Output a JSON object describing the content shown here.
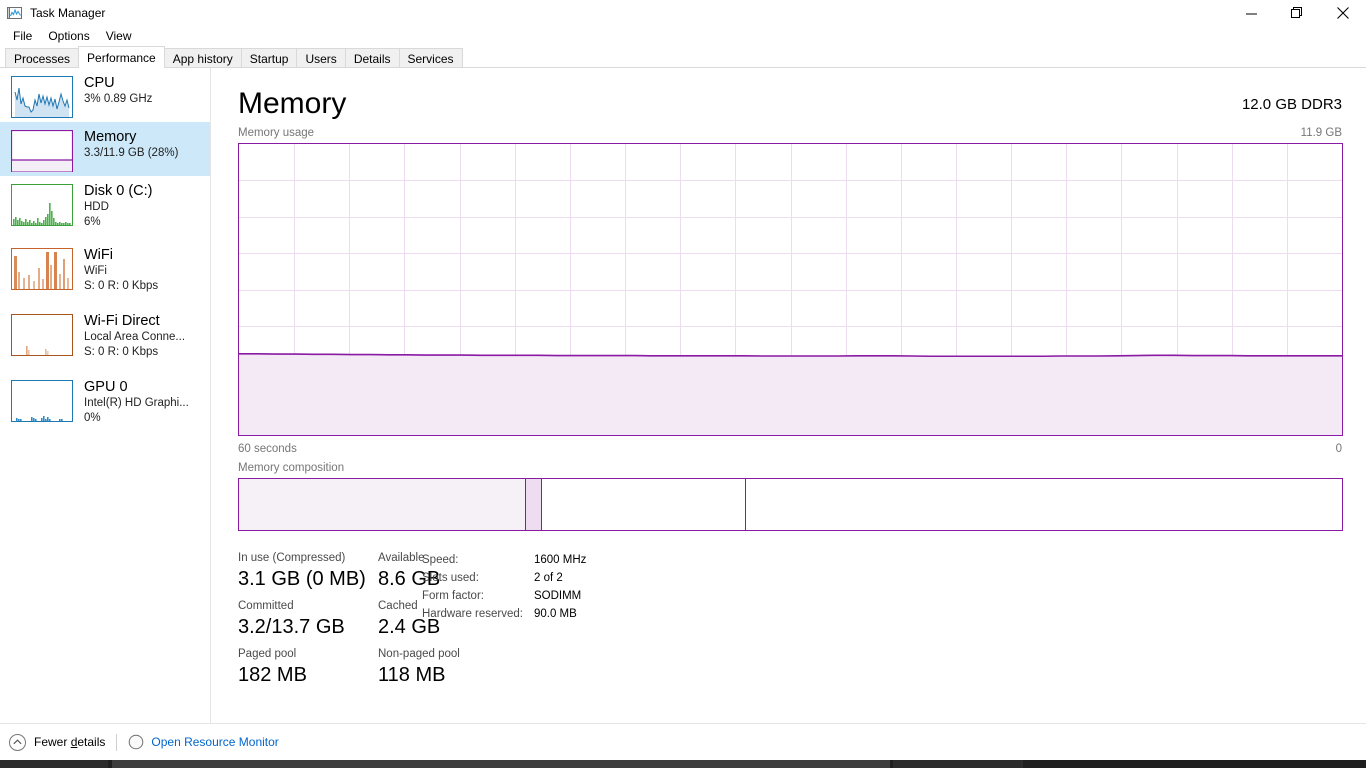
{
  "window": {
    "title": "Task Manager",
    "icon": "task-manager-icon",
    "controls": {
      "minimize": "—",
      "maximize": "❐",
      "close": "✕"
    }
  },
  "menubar": {
    "items": [
      "File",
      "Options",
      "View"
    ]
  },
  "tabs": [
    {
      "label": "Processes",
      "active": false
    },
    {
      "label": "Performance",
      "active": true
    },
    {
      "label": "App history",
      "active": false
    },
    {
      "label": "Startup",
      "active": false
    },
    {
      "label": "Users",
      "active": false
    },
    {
      "label": "Details",
      "active": false
    },
    {
      "label": "Services",
      "active": false
    }
  ],
  "sidebar": {
    "items": [
      {
        "name": "CPU",
        "line2": "3%  0.89 GHz",
        "line3": "",
        "color": "#1f77b4",
        "selected": false
      },
      {
        "name": "Memory",
        "line2": "3.3/11.9 GB (28%)",
        "line3": "",
        "color": "#8a19a3",
        "selected": true
      },
      {
        "name": "Disk 0 (C:)",
        "line2": "HDD",
        "line3": "6%",
        "color": "#3aa03a",
        "selected": false
      },
      {
        "name": "WiFi",
        "line2": "WiFi",
        "line3": "S: 0 R: 0 Kbps",
        "color": "#c4642a",
        "selected": false
      },
      {
        "name": "Wi-Fi Direct",
        "line2": "Local Area Conne...",
        "line3": "S: 0 R: 0 Kbps",
        "color": "#a8541f",
        "selected": false
      },
      {
        "name": "GPU 0",
        "line2": "Intel(R) HD Graphi...",
        "line3": "0%",
        "color": "#1f77b4",
        "selected": false
      }
    ]
  },
  "main": {
    "title": "Memory",
    "subtitle": "12.0 GB DDR3",
    "graph_label": "Memory usage",
    "graph_max": "11.9 GB",
    "graph_foot_left": "60 seconds",
    "graph_foot_right": "0",
    "composition_label": "Memory composition",
    "accent_color": "#8a19a3"
  },
  "chart_data": {
    "type": "area",
    "title": "Memory usage",
    "ylabel": "",
    "xlabel": "",
    "ylim": [
      0,
      11.9
    ],
    "xlim": [
      60,
      0
    ],
    "y_max_label": "11.9 GB",
    "x_left_label": "60 seconds",
    "x_right_label": "0",
    "grid": true,
    "grid_columns": 20,
    "grid_rows": 8,
    "line_color": "#8a19a3",
    "fill_color": "#f3eaf5",
    "series": [
      {
        "name": "In use",
        "unit": "GB",
        "values": [
          3.32,
          3.32,
          3.31,
          3.31,
          3.3,
          3.3,
          3.29,
          3.29,
          3.28,
          3.28,
          3.27,
          3.27,
          3.27,
          3.26,
          3.26,
          3.26,
          3.26,
          3.25,
          3.25,
          3.25,
          3.25,
          3.25,
          3.24,
          3.24,
          3.24,
          3.24,
          3.24,
          3.24,
          3.23,
          3.23,
          3.23,
          3.23,
          3.23,
          3.24,
          3.24,
          3.24,
          3.23,
          3.22,
          3.22,
          3.22,
          3.22,
          3.22,
          3.22,
          3.22,
          3.23,
          3.23,
          3.23,
          3.24,
          3.25,
          3.26,
          3.26,
          3.25,
          3.25,
          3.25,
          3.24,
          3.24,
          3.24,
          3.24,
          3.24,
          3.24
        ]
      }
    ]
  },
  "composition": {
    "segments": [
      {
        "name": "in-use",
        "width_pct": 25.9,
        "fill": "#f6f0f7"
      },
      {
        "name": "modified",
        "width_pct": 1.5,
        "fill": "#eedcf0"
      },
      {
        "name": "standby",
        "width_pct": 18.5,
        "fill": "#ffffff"
      },
      {
        "name": "free",
        "width_pct": 54.1,
        "fill": "#ffffff"
      }
    ]
  },
  "stats": {
    "cells": [
      {
        "label": "In use (Compressed)",
        "value": "3.1 GB (0 MB)"
      },
      {
        "label": "Available",
        "value": "8.6 GB"
      },
      {
        "label": "Committed",
        "value": "3.2/13.7 GB"
      },
      {
        "label": "Cached",
        "value": "2.4 GB"
      },
      {
        "label": "Paged pool",
        "value": "182 MB"
      },
      {
        "label": "Non-paged pool",
        "value": "118 MB"
      }
    ]
  },
  "specs": {
    "rows": [
      {
        "key": "Speed:",
        "value": "1600 MHz"
      },
      {
        "key": "Slots used:",
        "value": "2 of 2"
      },
      {
        "key": "Form factor:",
        "value": "SODIMM"
      },
      {
        "key": "Hardware reserved:",
        "value": "90.0 MB"
      }
    ]
  },
  "footer": {
    "fewer_details": "Fewer details",
    "fewer_details_pre": "Fewer ",
    "fewer_details_accesskey": "d",
    "fewer_details_post": "etails",
    "resource_monitor": "Open Resource Monitor"
  }
}
